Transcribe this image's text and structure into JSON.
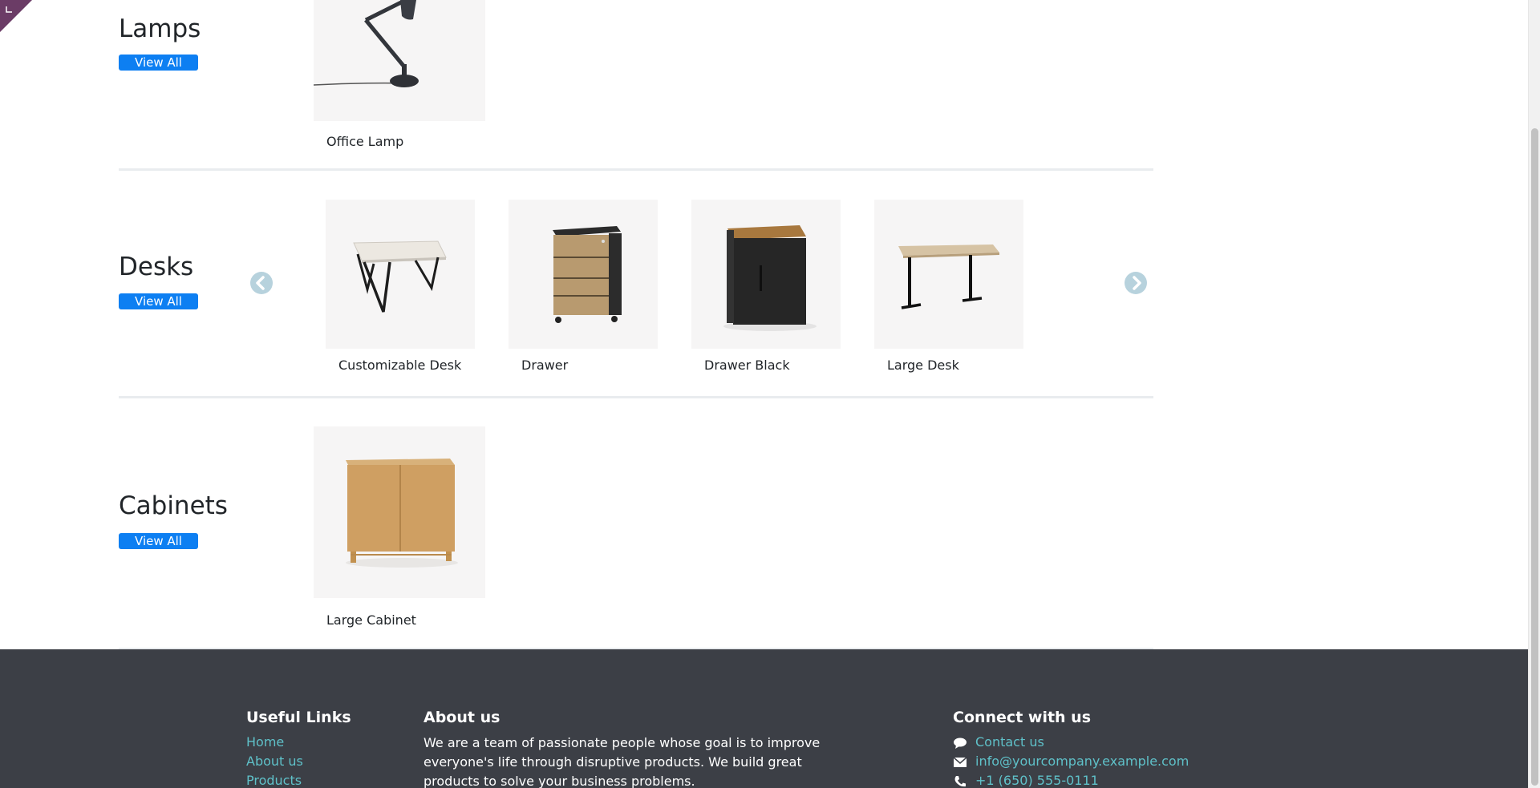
{
  "categories": {
    "lamps": {
      "title": "Lamps",
      "view_all": "View All",
      "products": [
        {
          "name": "Office Lamp"
        }
      ]
    },
    "desks": {
      "title": "Desks",
      "view_all": "View All",
      "products": [
        {
          "name": "Customizable Desk"
        },
        {
          "name": "Drawer"
        },
        {
          "name": "Drawer Black"
        },
        {
          "name": "Large Desk"
        }
      ]
    },
    "cabinets": {
      "title": "Cabinets",
      "view_all": "View All",
      "products": [
        {
          "name": "Large Cabinet"
        }
      ]
    }
  },
  "footer": {
    "useful_links": {
      "heading": "Useful Links",
      "links": [
        "Home",
        "About us",
        "Products"
      ]
    },
    "about": {
      "heading": "About us",
      "text": "We are a team of passionate people whose goal is to improve everyone's life through disruptive products. We build great products to solve your business problems."
    },
    "connect": {
      "heading": "Connect with us",
      "contact": "Contact us",
      "email": "info@yourcompany.example.com",
      "phone": "+1 (650) 555-0111"
    }
  },
  "colors": {
    "accent": "#0d7ff2",
    "footer_bg": "#3c3f46",
    "footer_link": "#5fc1c9",
    "corner": "#6b3c66"
  },
  "icons": [
    "chevron-left-icon",
    "chevron-right-icon",
    "comment-icon",
    "envelope-icon",
    "phone-icon"
  ]
}
